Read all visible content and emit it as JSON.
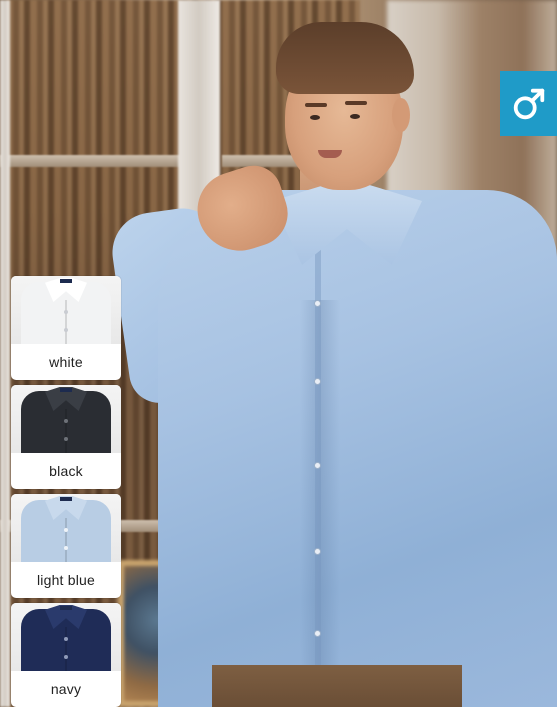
{
  "badge": {
    "icon": "male-symbol-icon",
    "color": "#1f9bc8"
  },
  "swatches": [
    {
      "label": "white",
      "shirt_color": "#f2f3f4",
      "collar_color": "#ffffff",
      "button_color": "#c9ccd2"
    },
    {
      "label": "black",
      "shirt_color": "#2a2d33",
      "collar_color": "#3a3e45",
      "button_color": "#6d7178"
    },
    {
      "label": "light blue",
      "shirt_color": "#b8cde4",
      "collar_color": "#c8d9ec",
      "button_color": "#eef3f8"
    },
    {
      "label": "navy",
      "shirt_color": "#1f2c57",
      "collar_color": "#2a3a6c",
      "button_color": "#8f9ab8"
    }
  ]
}
